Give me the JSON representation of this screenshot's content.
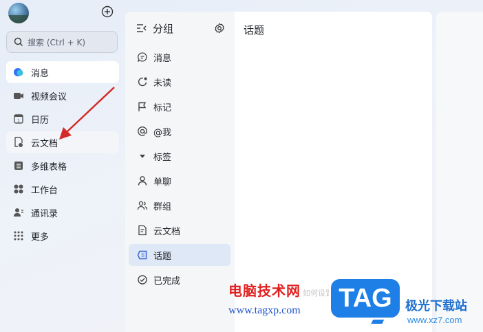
{
  "search": {
    "placeholder": "搜索 (Ctrl + K)"
  },
  "nav": {
    "items": [
      {
        "label": "消息",
        "icon": "message-icon"
      },
      {
        "label": "视频会议",
        "icon": "video-icon"
      },
      {
        "label": "日历",
        "icon": "calendar-icon"
      },
      {
        "label": "云文档",
        "icon": "cloud-doc-icon"
      },
      {
        "label": "多维表格",
        "icon": "table-icon"
      },
      {
        "label": "工作台",
        "icon": "workspace-icon"
      },
      {
        "label": "通讯录",
        "icon": "contacts-icon"
      },
      {
        "label": "更多",
        "icon": "more-icon"
      }
    ]
  },
  "groups": {
    "title": "分组",
    "items": [
      {
        "label": "消息"
      },
      {
        "label": "未读"
      },
      {
        "label": "标记"
      },
      {
        "label": "@我"
      },
      {
        "label": "标签"
      },
      {
        "label": "单聊"
      },
      {
        "label": "群组"
      },
      {
        "label": "云文档"
      },
      {
        "label": "话题"
      },
      {
        "label": "已完成"
      }
    ]
  },
  "main": {
    "title": "话题"
  },
  "watermark": {
    "line1": "电脑技术网",
    "line2": "www.tagxp.com",
    "tag": "TAG",
    "brand": "极光下载站",
    "brand_url": "www.xz7.com",
    "faded": "如何设置话题"
  },
  "colors": {
    "accent": "#1e7fe6",
    "arrow": "#d42a2a",
    "active_group": "#dfe8f6"
  }
}
